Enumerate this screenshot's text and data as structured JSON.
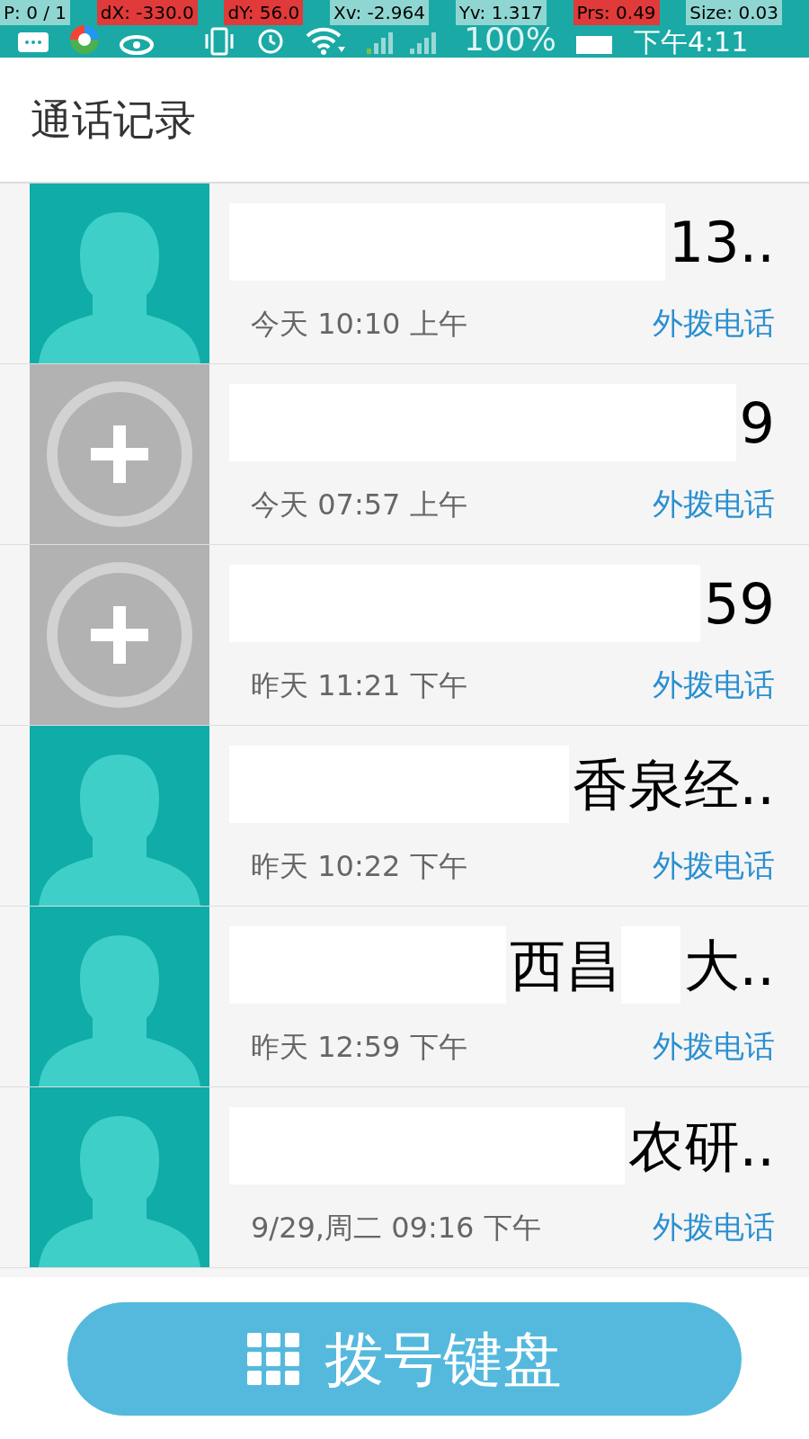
{
  "debug_overlay": [
    {
      "text": "P: 0 / 1",
      "highlighted": false
    },
    {
      "text": "dX: -330.0",
      "highlighted": true
    },
    {
      "text": "dY: 56.0",
      "highlighted": true
    },
    {
      "text": "Xv: -2.964",
      "highlighted": false
    },
    {
      "text": "Yv: 1.317",
      "highlighted": false
    },
    {
      "text": "Prs: 0.49",
      "highlighted": true
    },
    {
      "text": "Size: 0.03",
      "highlighted": false
    }
  ],
  "status_bar": {
    "battery": "100%",
    "time": "下午4:11"
  },
  "header": {
    "title": "通话记录"
  },
  "calls": [
    {
      "kind": "contact",
      "name_parts": [
        "13.."
      ],
      "time": "今天 10:10 上午",
      "type": "外拨电话"
    },
    {
      "kind": "unknown",
      "name_parts": [
        "9"
      ],
      "time": "今天 07:57 上午",
      "type": "外拨电话"
    },
    {
      "kind": "unknown",
      "name_parts": [
        "59"
      ],
      "time": "昨天 11:21 下午",
      "type": "外拨电话"
    },
    {
      "kind": "contact",
      "name_parts": [
        "香泉经.."
      ],
      "time": "昨天 10:22 下午",
      "type": "外拨电话"
    },
    {
      "kind": "contact",
      "name_parts": [
        "西昌",
        "大.."
      ],
      "time": "昨天 12:59 下午",
      "type": "外拨电话"
    },
    {
      "kind": "contact",
      "name_parts": [
        "农研.."
      ],
      "time": "9/29,周二 09:16 下午",
      "type": "外拨电话"
    }
  ],
  "dialpad_button": {
    "label": "拨号键盘"
  }
}
